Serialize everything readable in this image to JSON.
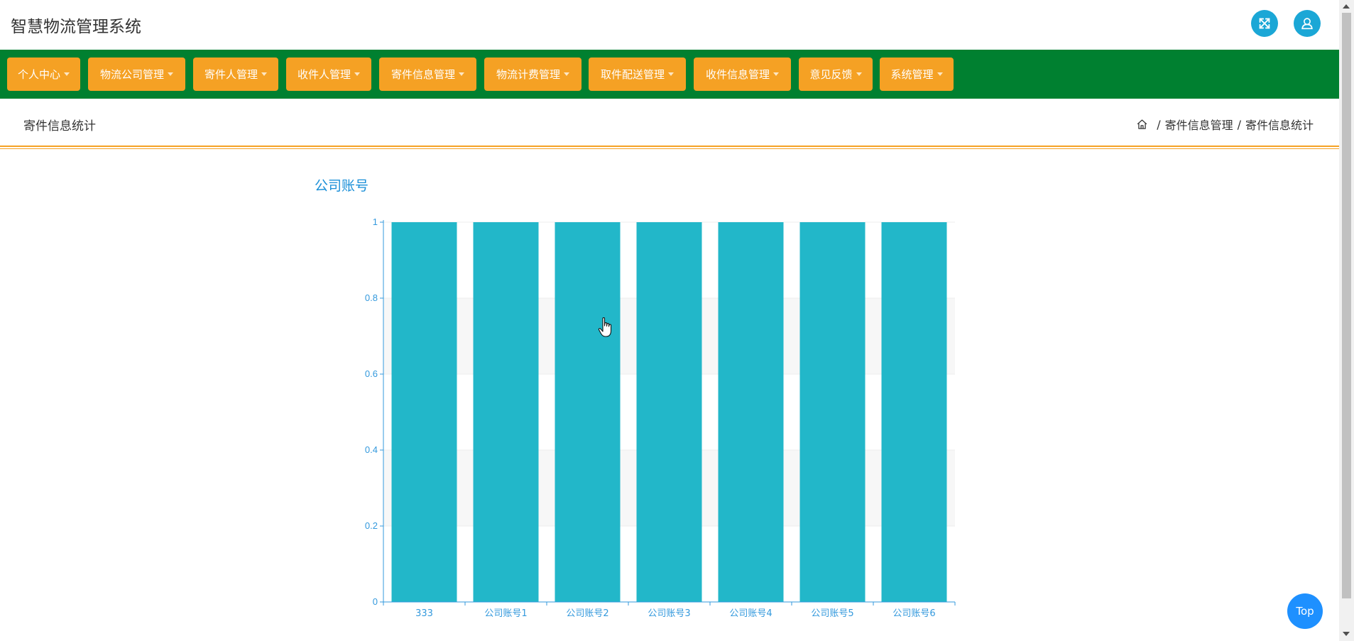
{
  "header": {
    "app_title": "智慧物流管理系统",
    "fullscreen_icon": "expand-icon",
    "user_icon": "user-icon",
    "accent_color": "#1ba7d6"
  },
  "nav": {
    "background_color": "#008030",
    "item_color": "#f5a124",
    "items": [
      {
        "label": "个人中心"
      },
      {
        "label": "物流公司管理"
      },
      {
        "label": "寄件人管理"
      },
      {
        "label": "收件人管理"
      },
      {
        "label": "寄件信息管理"
      },
      {
        "label": "物流计费管理"
      },
      {
        "label": "取件配送管理"
      },
      {
        "label": "收件信息管理"
      },
      {
        "label": "意见反馈"
      },
      {
        "label": "系统管理"
      }
    ]
  },
  "page": {
    "title": "寄件信息统计",
    "breadcrumb": {
      "home_icon": "home-icon",
      "separator": "/",
      "items": [
        "寄件信息管理",
        "寄件信息统计"
      ]
    }
  },
  "chart_data": {
    "type": "bar",
    "title": "公司账号",
    "categories": [
      "333",
      "公司账号1",
      "公司账号2",
      "公司账号3",
      "公司账号4",
      "公司账号5",
      "公司账号6"
    ],
    "values": [
      1,
      1,
      1,
      1,
      1,
      1,
      1
    ],
    "ylim": [
      0,
      1
    ],
    "yticks": [
      "0",
      "0.2",
      "0.4",
      "0.6",
      "0.8",
      "1"
    ],
    "grid": true,
    "bar_color": "#22b7c9",
    "axis_color": "#3399dd"
  },
  "footer": {
    "top_button_label": "Top"
  }
}
